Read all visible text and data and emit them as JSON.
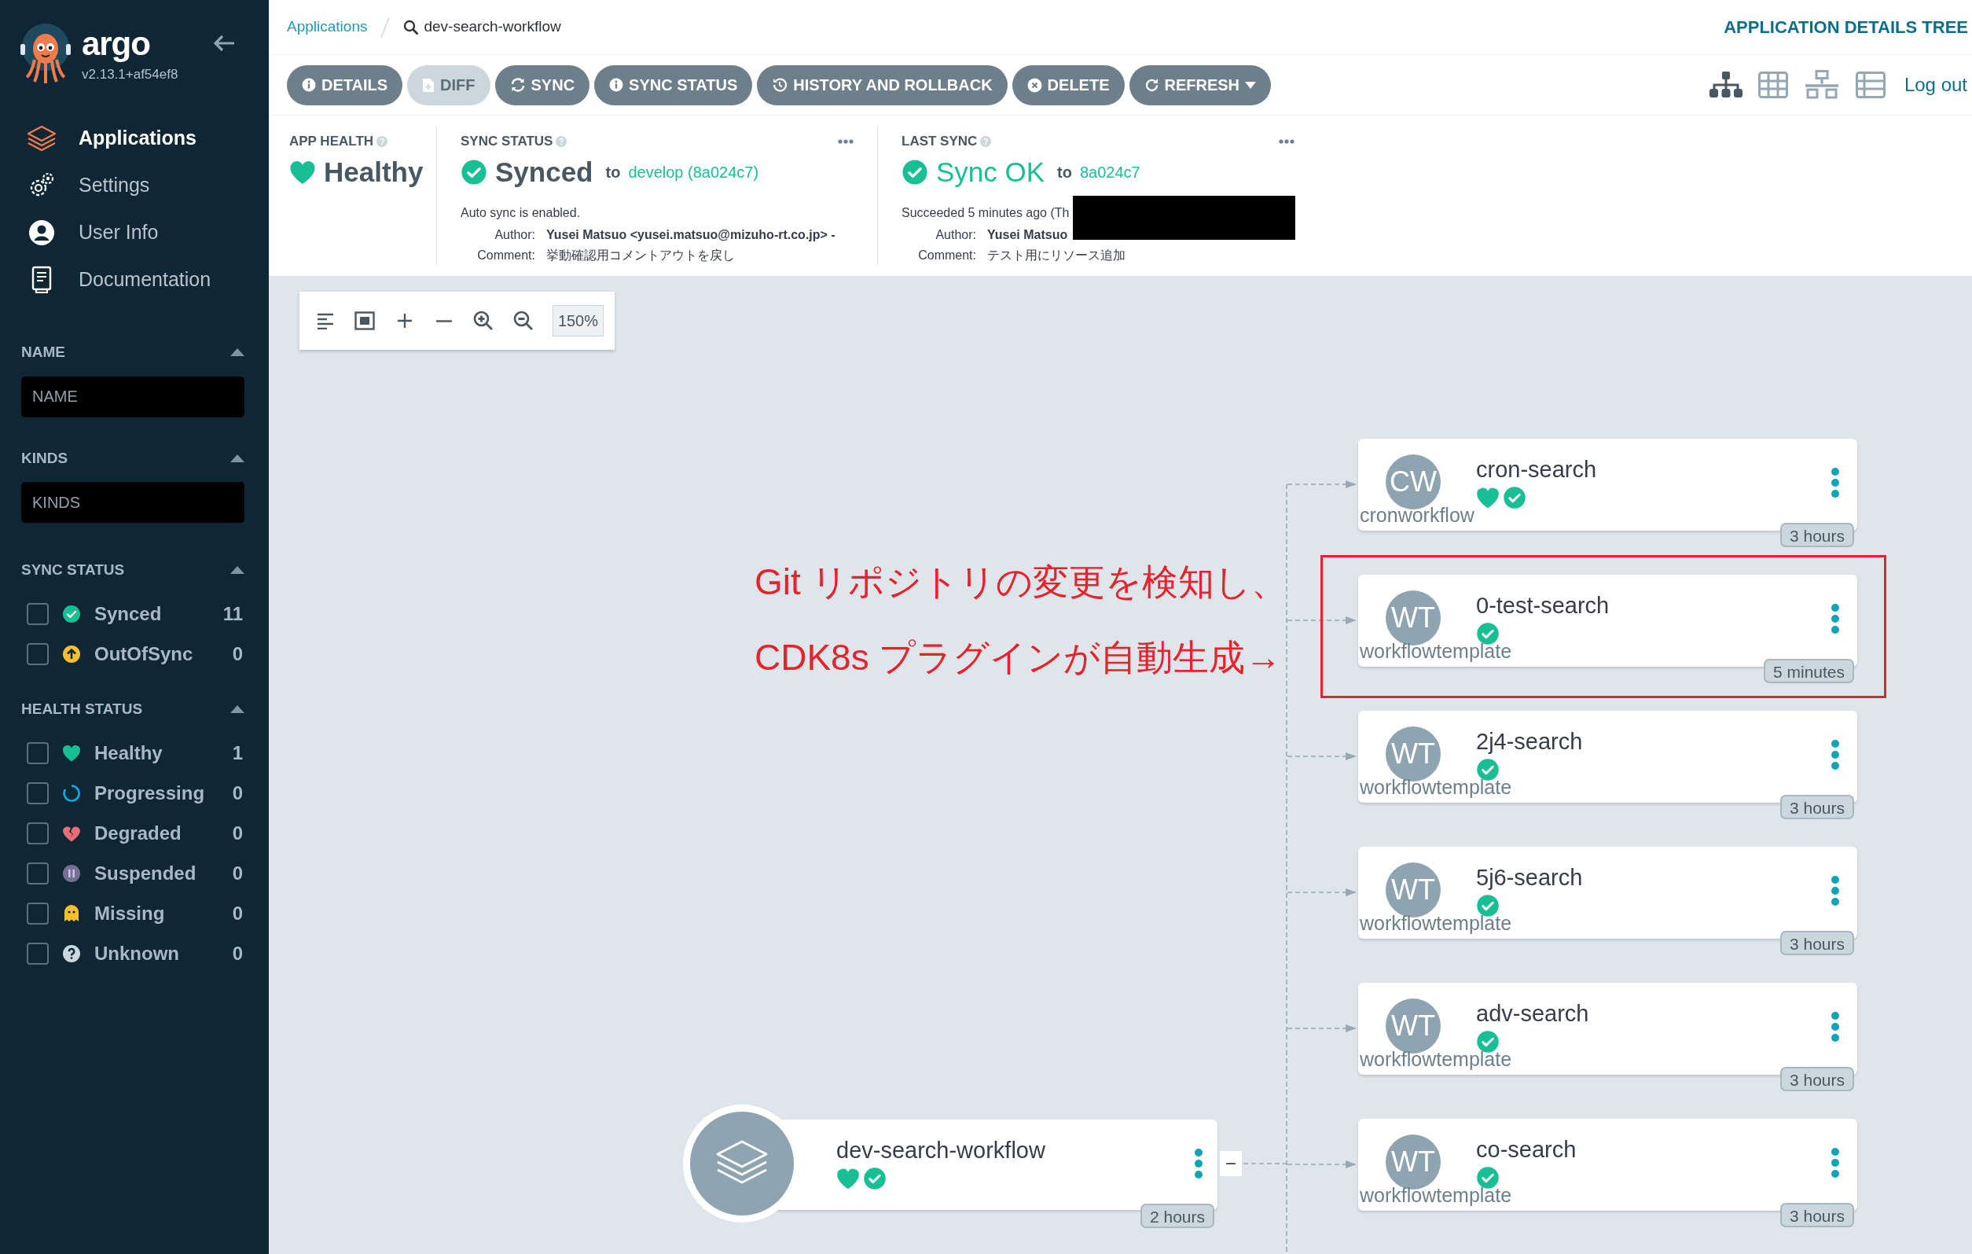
{
  "sidebar": {
    "logo_text": "argo",
    "version": "v2.13.1+af54ef8",
    "nav": [
      {
        "label": "Applications",
        "selected": true
      },
      {
        "label": "Settings",
        "selected": false
      },
      {
        "label": "User Info",
        "selected": false
      },
      {
        "label": "Documentation",
        "selected": false
      }
    ],
    "name_filter": {
      "title": "NAME",
      "placeholder": "NAME"
    },
    "kinds_filter": {
      "title": "KINDS",
      "placeholder": "KINDS"
    },
    "sync_status": {
      "title": "SYNC STATUS",
      "items": [
        {
          "label": "Synced",
          "kind": "synced",
          "count": "11",
          "checked": false
        },
        {
          "label": "OutOfSync",
          "kind": "outofsync",
          "count": "0",
          "checked": false
        }
      ]
    },
    "health_status": {
      "title": "HEALTH STATUS",
      "items": [
        {
          "label": "Healthy",
          "kind": "healthy",
          "count": "1",
          "checked": false
        },
        {
          "label": "Progressing",
          "kind": "progressing",
          "count": "0",
          "checked": false
        },
        {
          "label": "Degraded",
          "kind": "degraded",
          "count": "0",
          "checked": false
        },
        {
          "label": "Suspended",
          "kind": "suspended",
          "count": "0",
          "checked": false
        },
        {
          "label": "Missing",
          "kind": "missing",
          "count": "0",
          "checked": false
        },
        {
          "label": "Unknown",
          "kind": "unknown",
          "count": "0",
          "checked": false
        }
      ]
    }
  },
  "breadcrumb": {
    "parent": "Applications",
    "current": "dev-search-workflow"
  },
  "page_title": "APPLICATION DETAILS TREE",
  "toolbar": {
    "buttons": [
      {
        "label": "DETAILS",
        "disabled": false,
        "dropdown": false
      },
      {
        "label": "DIFF",
        "disabled": true,
        "dropdown": false
      },
      {
        "label": "SYNC",
        "disabled": false,
        "dropdown": false
      },
      {
        "label": "SYNC STATUS",
        "disabled": false,
        "dropdown": false
      },
      {
        "label": "HISTORY AND ROLLBACK",
        "disabled": false,
        "dropdown": false
      },
      {
        "label": "DELETE",
        "disabled": false,
        "dropdown": false
      },
      {
        "label": "REFRESH",
        "disabled": false,
        "dropdown": true
      }
    ],
    "view_modes": [
      {
        "kind": "tree",
        "selected": true
      },
      {
        "kind": "grid",
        "selected": false
      },
      {
        "kind": "network",
        "selected": false
      },
      {
        "kind": "list",
        "selected": false
      }
    ],
    "logout": "Log out"
  },
  "summary": {
    "app_health": {
      "title": "APP HEALTH",
      "status": "Healthy"
    },
    "sync_status": {
      "title": "SYNC STATUS",
      "status": "Synced",
      "to": "to",
      "revision": "develop (8a024c7)",
      "note": "Auto sync is enabled.",
      "author_label": "Author:",
      "author": "Yusei Matsuo <yusei.matsuo@mizuho-rt.co.jp> -",
      "comment_label": "Comment:",
      "comment": "挙動確認用コメントアウトを戻し"
    },
    "last_sync": {
      "title": "LAST SYNC",
      "status": "Sync OK",
      "to": "to",
      "revision": "8a024c7",
      "note": "Succeeded 5 minutes ago (Th",
      "author_label": "Author:",
      "author": "Yusei Matsuo",
      "comment_label": "Comment:",
      "comment": "テスト用にリソース追加"
    }
  },
  "zoom_toolbar": {
    "zoom": "150%"
  },
  "annotation": {
    "lines": [
      "Git リポジトリの変更を検知し、",
      "CDK8s プラグインが自動生成→"
    ]
  },
  "graph": {
    "root": {
      "name": "dev-search-workflow",
      "age": "2 hours",
      "healthy": true,
      "synced": true,
      "collapse_label": "−"
    },
    "resources": [
      {
        "abbr": "CW",
        "name": "cron-search",
        "kind_label": "cronworkflow",
        "age": "3 hours",
        "healthy": true,
        "synced": true,
        "highlighted": false
      },
      {
        "abbr": "WT",
        "name": "0-test-search",
        "kind_label": "workflowtemplate",
        "age": "5 minutes",
        "healthy": false,
        "synced": true,
        "highlighted": true
      },
      {
        "abbr": "WT",
        "name": "2j4-search",
        "kind_label": "workflowtemplate",
        "age": "3 hours",
        "healthy": false,
        "synced": true,
        "highlighted": false
      },
      {
        "abbr": "WT",
        "name": "5j6-search",
        "kind_label": "workflowtemplate",
        "age": "3 hours",
        "healthy": false,
        "synced": true,
        "highlighted": false
      },
      {
        "abbr": "WT",
        "name": "adv-search",
        "kind_label": "workflowtemplate",
        "age": "3 hours",
        "healthy": false,
        "synced": true,
        "highlighted": false
      },
      {
        "abbr": "WT",
        "name": "co-search",
        "kind_label": "workflowtemplate",
        "age": "3 hours",
        "healthy": false,
        "synced": true,
        "highlighted": false
      }
    ]
  }
}
